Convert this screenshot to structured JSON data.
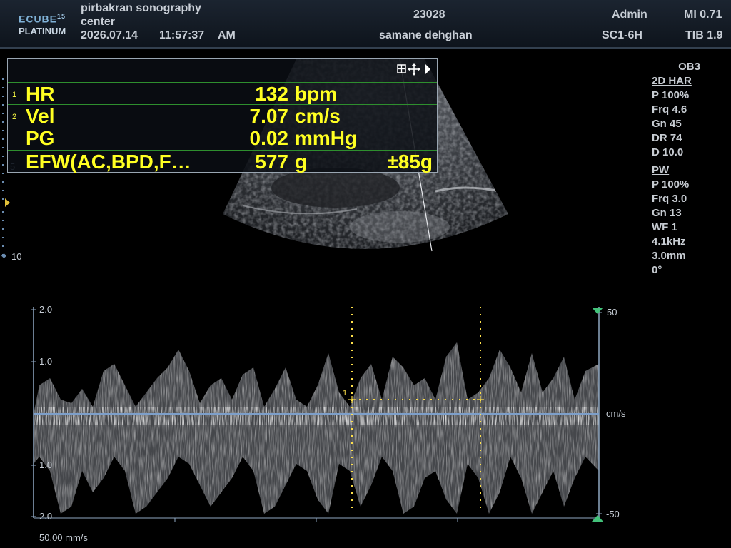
{
  "header": {
    "logo_top": "ECUBE",
    "logo_version": "15",
    "logo_bottom": "PLATINUM",
    "clinic_line1": "pirbakran sonography",
    "clinic_line2": "center",
    "date": "2026.07.14",
    "time": "11:57:37",
    "ampm": "AM",
    "patient_id": "23028",
    "patient_name": "samane dehghan",
    "operator": "Admin",
    "probe": "SC1-6H",
    "mi": "MI 0.71",
    "tib": "TIB 1.9"
  },
  "measurements": {
    "toolbar_icons": [
      "grid-icon",
      "move-icon",
      "play-icon"
    ],
    "rows": [
      {
        "index": "1",
        "name": "HR",
        "value": "132",
        "unit": "bpm",
        "extra": ""
      },
      {
        "index": "2",
        "name": "Vel",
        "value": "7.07",
        "unit": "cm/s",
        "extra": ""
      },
      {
        "index": "",
        "name": "PG",
        "value": "0.02",
        "unit": "mmHg",
        "extra": ""
      },
      {
        "index": "",
        "name": "EFW(AC,BPD,F…",
        "value": "577",
        "unit": "g",
        "extra": "±85g"
      }
    ]
  },
  "params": {
    "preset": "OB3",
    "mode_2d": "2D HAR",
    "p_2d": "P 100%",
    "frq_2d": "Frq 4.6",
    "gn_2d": "Gn 45",
    "dr_2d": "DR 74",
    "d_2d": "D 10.0",
    "mode_pw": "PW",
    "p_pw": "P 100%",
    "frq_pw": "Frq 3.0",
    "gn_pw": "Gn 13",
    "wf_pw": "WF 1",
    "prf_pw": "4.1kHz",
    "sv_pw": "3.0mm",
    "angle_pw": "0°"
  },
  "depth_ruler": {
    "label_5": "5",
    "label_10": "10"
  },
  "doppler": {
    "left_scale": [
      "2.0",
      "1.0",
      "1.0",
      "2.0"
    ],
    "right_top": "50",
    "right_mid": "cm/s",
    "right_bottom": "-50",
    "sweep_speed": "50.00 mm/s",
    "caliper_label": "1"
  }
}
